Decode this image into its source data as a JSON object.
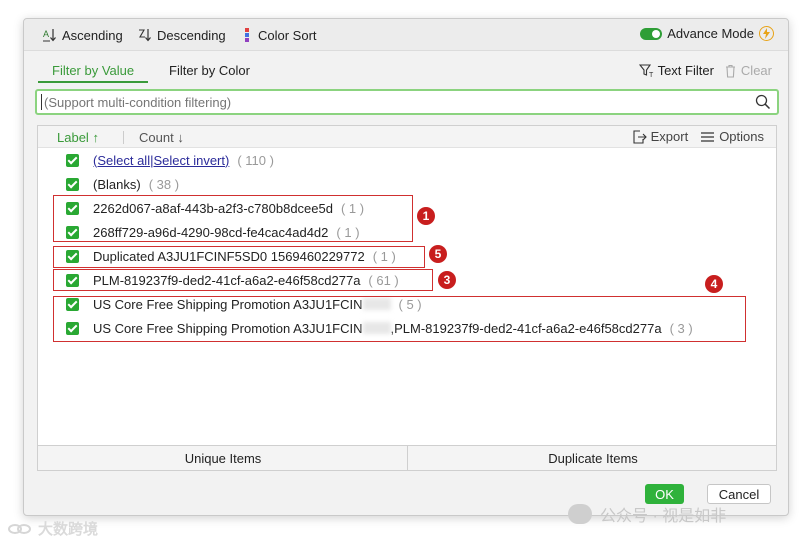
{
  "toolbar": {
    "ascending": "Ascending",
    "descending": "Descending",
    "color_sort": "Color Sort",
    "advance_mode": "Advance Mode",
    "advance_mode_on": true
  },
  "tabs": [
    {
      "label": "Filter by Value",
      "active": true
    },
    {
      "label": "Filter by Color",
      "active": false
    }
  ],
  "tools": {
    "text_filter": "Text Filter",
    "clear": "Clear"
  },
  "search": {
    "placeholder": "(Support multi-condition filtering)",
    "value": ""
  },
  "list_header": {
    "label": "Label",
    "label_sort": "↑",
    "count": "Count",
    "count_sort": "↓",
    "export": "Export",
    "options": "Options"
  },
  "select_row": {
    "select_all": "(Select all",
    "separator": "|",
    "select_invert": "Select invert)",
    "count": "( 110 )"
  },
  "items": [
    {
      "label": "(Blanks)",
      "count": "( 38 )",
      "checked": true
    },
    {
      "label": "2262d067-a8af-443b-a2f3-c780b8dcee5d",
      "count": "( 1 )",
      "checked": true
    },
    {
      "label": "268ff729-a96d-4290-98cd-fe4cac4ad4d2",
      "count": "( 1 )",
      "checked": true
    },
    {
      "label": "Duplicated A3JU1FCINF5SD0 1569460229772",
      "count": "( 1 )",
      "checked": true
    },
    {
      "label": "PLM-819237f9-ded2-41cf-a6a2-e46f58cd277a",
      "count": "( 61 )",
      "checked": true
    },
    {
      "label_start": "US Core Free Shipping Promotion A3JU1FCIN",
      "label_end": "",
      "count": "( 5 )",
      "checked": true
    },
    {
      "label_start": "US Core Free Shipping Promotion A3JU1FCIN",
      "label_end": ",PLM-819237f9-ded2-41cf-a6a2-e46f58cd277a",
      "count": "( 3 )",
      "checked": true
    }
  ],
  "annotations": [
    "1",
    "5",
    "3",
    "4"
  ],
  "annotation_color": "#c81e1e",
  "bottom": {
    "unique": "Unique Items",
    "duplicate": "Duplicate Items"
  },
  "actions": {
    "ok": "OK",
    "cancel": "Cancel"
  },
  "accent_color": "#2fb23b",
  "watermark": {
    "left": "大数跨境",
    "right": "公众号 · 视是如非"
  }
}
